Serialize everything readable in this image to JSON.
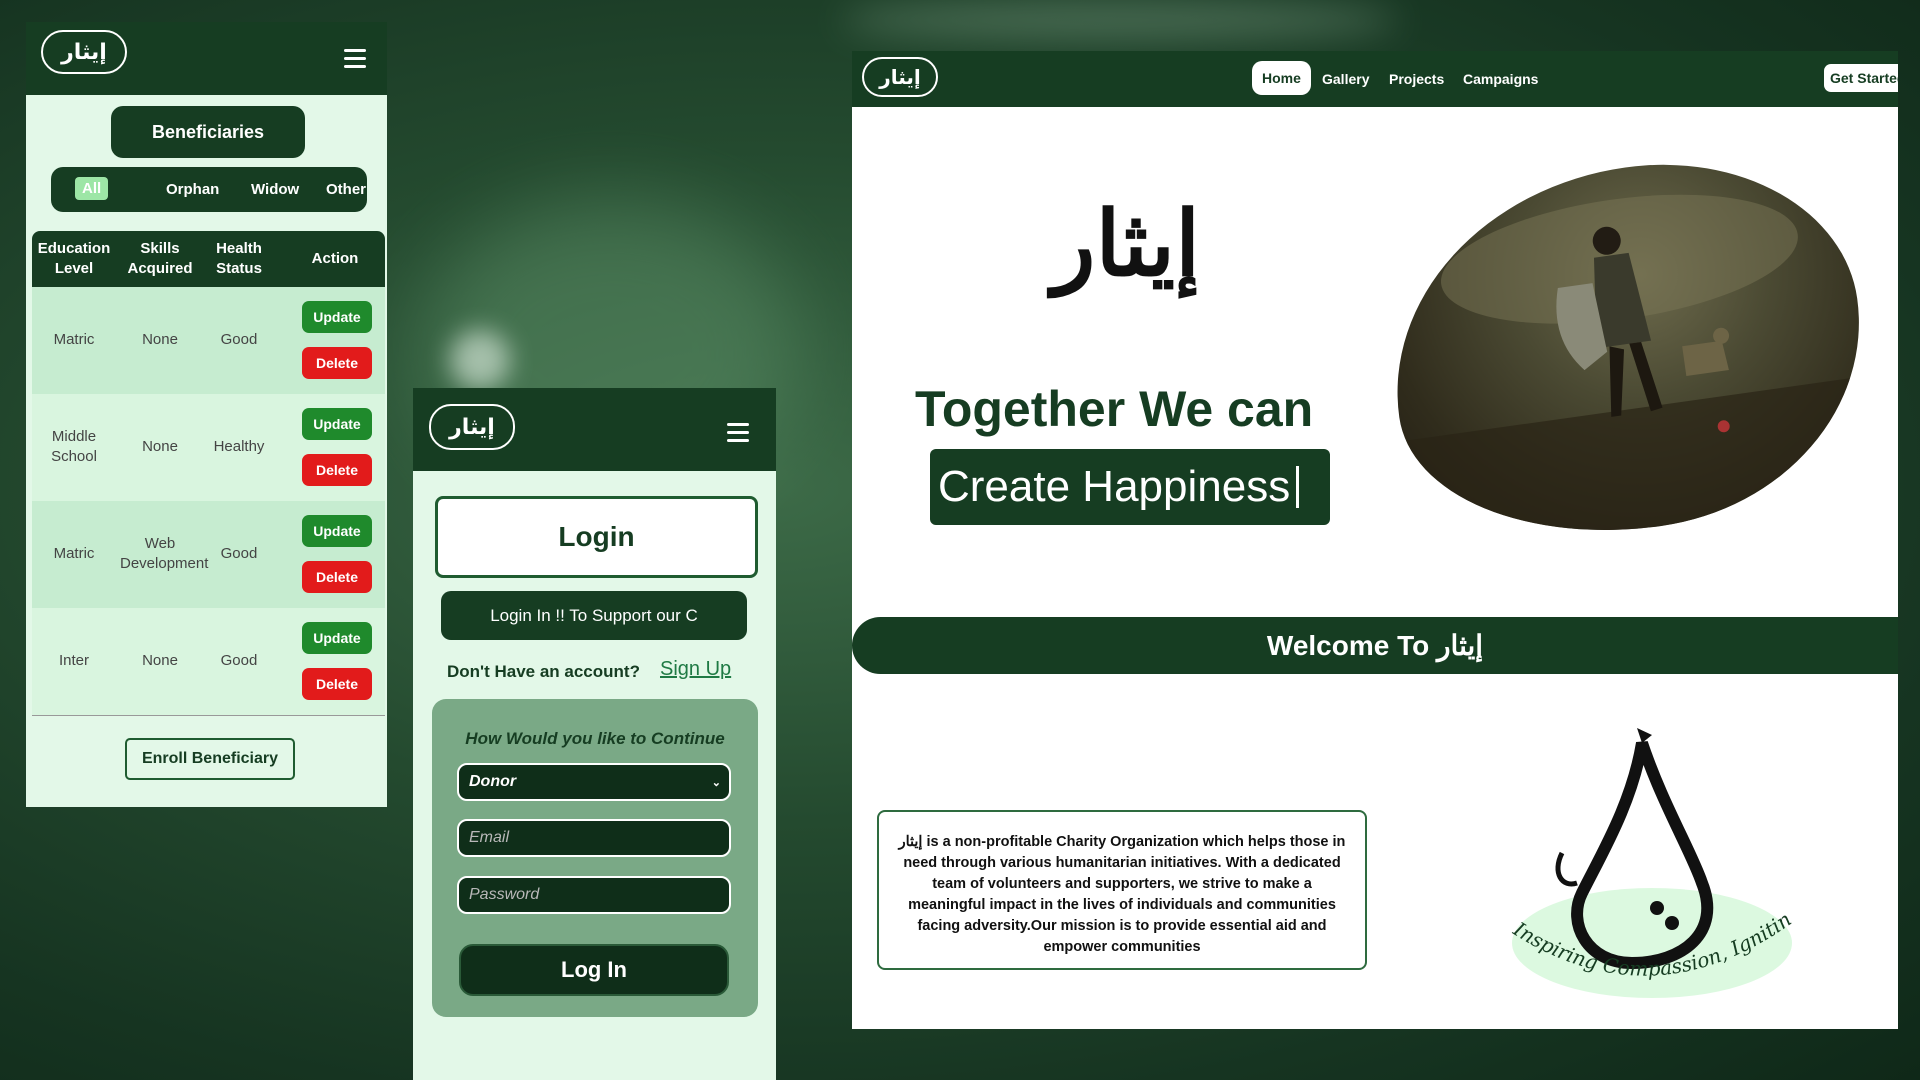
{
  "brand": {
    "logo_text": "إيثار"
  },
  "beneficiaries_panel": {
    "title": "Beneficiaries",
    "filters": [
      "All",
      "Orphan",
      "Widow",
      "Other"
    ],
    "active_filter": "All",
    "columns": [
      "Education Level",
      "Skills Acquired",
      "Health Status",
      "Action"
    ],
    "rows": [
      {
        "education": "Matric",
        "skills": "None",
        "health": "Good"
      },
      {
        "education": "Middle School",
        "skills": "None",
        "health": "Healthy"
      },
      {
        "education": "Matric",
        "skills": "Web Development",
        "health": "Good"
      },
      {
        "education": "Inter",
        "skills": "None",
        "health": "Good"
      }
    ],
    "update_label": "Update",
    "delete_label": "Delete",
    "enroll_label": "Enroll Beneficiary"
  },
  "login_panel": {
    "heading": "Login",
    "support_button": "Login In !! To Support our C",
    "no_account_text": "Don't Have an account?",
    "signup_link": "Sign Up",
    "continue_title": "How Would you like to Continue",
    "role_selected": "Donor",
    "email_placeholder": "Email",
    "password_placeholder": "Password",
    "login_button": "Log In"
  },
  "home_panel": {
    "nav": [
      "Home",
      "Gallery",
      "Projects",
      "Campaigns"
    ],
    "active_nav": "Home",
    "get_started": "Get Started",
    "hero_arabic": "إيثار",
    "hero_title": "Together We can",
    "hero_subtitle": "Create Happiness",
    "welcome_text": "Welcome To إيثار",
    "about_text": "إيثار is a non-profitable Charity Organization which helps those in need through various humanitarian initiatives. With a dedicated team of volunteers and supporters, we strive to make a meaningful impact in the lives of individuals and communities facing adversity.Our mission is to provide essential aid and empower communities",
    "logo_tagline": "Inspiring Compassion, Igniting Change"
  },
  "colors": {
    "primary": "#163d22",
    "update": "#1f8a2c",
    "delete": "#e21b1b",
    "panel_bg": "#e3f8e8"
  }
}
